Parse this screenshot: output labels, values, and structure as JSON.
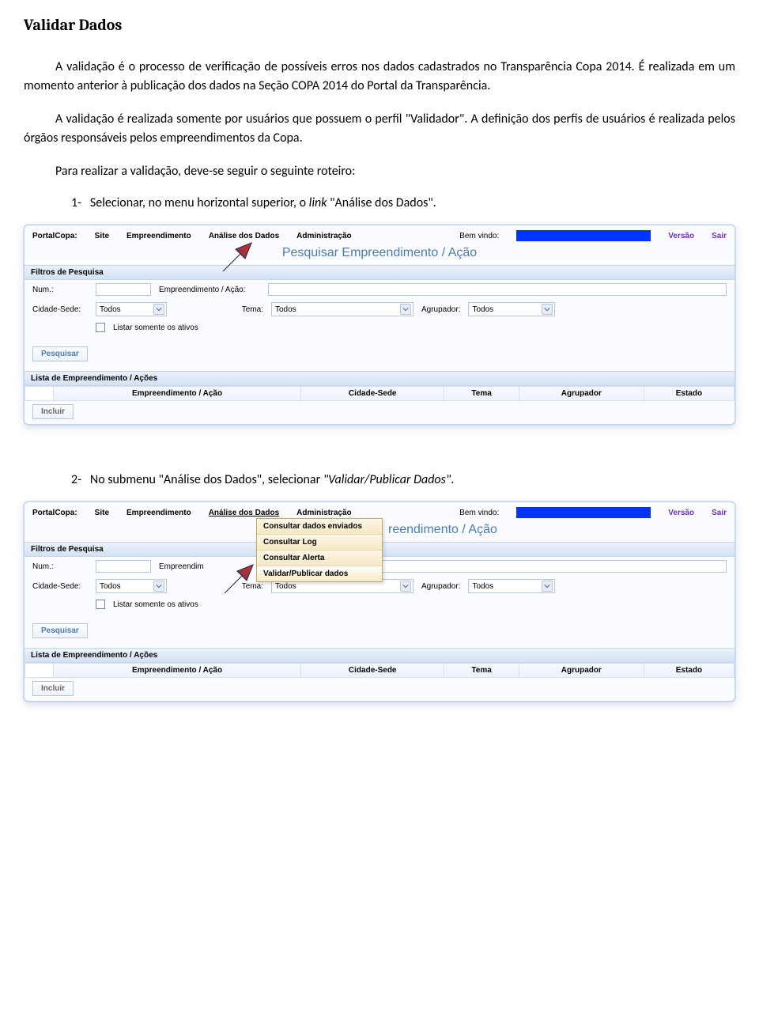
{
  "doc": {
    "title": "Validar Dados",
    "p1": "A validação é o processo de verificação de possíveis erros nos dados cadastrados no Transparência Copa 2014. É realizada em um momento anterior à publicação dos dados na Seção COPA 2014 do Portal da Transparência.",
    "p2": "A validação é realizada somente por usuários que possuem o perfil \"Validador\". A definição dos perfis de usuários é realizada pelos órgãos responsáveis pelos empreendimentos da Copa.",
    "p3": "Para realizar a validação, deve-se seguir o seguinte roteiro:",
    "step1_prefix": "1-",
    "step1_text": "Selecionar, no menu horizontal superior, o ",
    "step1_link": "link",
    "step1_tail": " \"Análise dos Dados\".",
    "step2_prefix": "2-",
    "step2_text": "No submenu \"Análise dos Dados\", selecionar ",
    "step2_em": "\"Validar/Publicar Dados\"",
    "step2_tail": "."
  },
  "app": {
    "brand": "PortalCopa:",
    "menu": [
      "Site",
      "Empreendimento",
      "Análise dos Dados",
      "Administração"
    ],
    "welcome": "Bem vindo:",
    "version": "Versão",
    "exit": "Sair",
    "page_title": "Pesquisar Empreendimento / Ação",
    "filters_hdr": "Filtros de Pesquisa",
    "labels": {
      "num": "Num.:",
      "empreend": "Empreendimento / Ação:",
      "cidade": "Cidade-Sede:",
      "tema": "Tema:",
      "agrupador": "Agrupador:",
      "listar_ativos": "Listar somente os ativos"
    },
    "values": {
      "todos": "Todos"
    },
    "buttons": {
      "pesquisar": "Pesquisar",
      "incluir": "Incluir"
    },
    "list_hdr": "Lista de Empreendimento / Ações",
    "columns": [
      "Empreendimento / Ação",
      "Cidade-Sede",
      "Tema",
      "Agrupador",
      "Estado"
    ],
    "submenu": [
      "Consultar dados enviados",
      "Consultar Log",
      "Consultar Alerta",
      "Validar/Publicar dados"
    ],
    "page_title_cut": "reendimento / Ação",
    "empreend_cut": "Empreendim",
    "acao_cut": "/ Ação:"
  }
}
